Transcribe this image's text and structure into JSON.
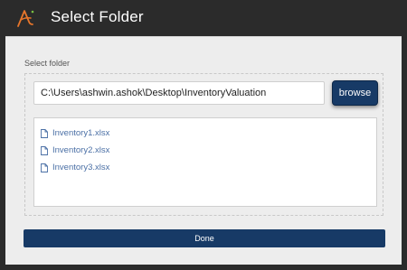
{
  "window": {
    "title": "Select Folder",
    "logo_icon": "app-logo-icon",
    "accent_color": "#e8762b"
  },
  "dialog": {
    "section_label": "Select folder",
    "path_value": "C:\\Users\\ashwin.ashok\\Desktop\\InventoryValuation",
    "browse_label": "browse",
    "files": [
      {
        "name": "Inventory1.xlsx",
        "icon": "file-icon"
      },
      {
        "name": "Inventory2.xlsx",
        "icon": "file-icon"
      },
      {
        "name": "Inventory3.xlsx",
        "icon": "file-icon"
      }
    ],
    "done_label": "Done",
    "button_color": "#173a66"
  }
}
